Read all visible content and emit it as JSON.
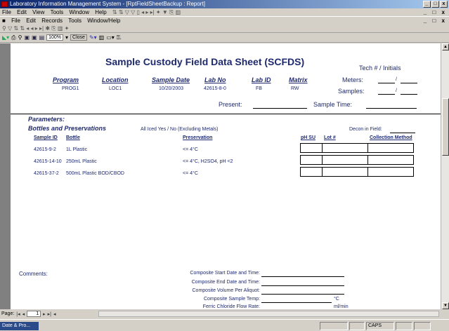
{
  "window": {
    "title": "Laboratory Information Management System - [RptFieldSheetBackup : Report]",
    "controls": [
      "_",
      "□",
      "x"
    ]
  },
  "menubar1": {
    "items": [
      "File",
      "Edit",
      "View",
      "Tools",
      "Window",
      "Help"
    ],
    "controls": [
      "_",
      "□",
      "x"
    ]
  },
  "menubar2": {
    "items": [
      "File",
      "Edit",
      "Records",
      "Tools",
      "Window/Help"
    ],
    "controls": [
      "_",
      "□",
      "x"
    ]
  },
  "toolbar": {
    "zoom": "100%",
    "close_label": "Close"
  },
  "report": {
    "title": "Sample Custody Field Data Sheet  (SCFDS)",
    "tech_label": "Tech # / Initials",
    "headers": {
      "program": "Program",
      "location": "Location",
      "sample_date": "Sample Date",
      "lab_no": "Lab No",
      "lab_id": "Lab ID",
      "matrix": "Matrix"
    },
    "values": {
      "program": "PROG1",
      "location": "LOC1",
      "sample_date": "10/20/2003",
      "lab_no": "42615-8-0",
      "lab_id": "FB",
      "matrix": "RW"
    },
    "meters_label": "Meters:",
    "samples_label": "Samples:",
    "slash": "/",
    "present_label": "Present:",
    "sample_time_label": "Sample Time:",
    "parameters_label": "Parameters:",
    "bottles_label": "Bottles and Preservations",
    "all_iced": "All Iced  Yes / No  (Excluding Metals)",
    "decon_label": "Decon in Field:",
    "columns": {
      "sample_id": "Sample ID",
      "bottle": "Bottle",
      "preservation": "Preservation",
      "ph_su": "pH SU",
      "lot": "Lot #",
      "collection_method": "Collection Method"
    },
    "rows": [
      {
        "sample_id": "42615-9-2",
        "bottle": "1L Plastic",
        "preservation": "<= 4°C"
      },
      {
        "sample_id": "42615-14-10",
        "bottle": "250mL Plastic",
        "preservation": "<= 4°C, H2SO4, pH <2"
      },
      {
        "sample_id": "42615-37-2",
        "bottle": "500mL Plastic BOD/CBOD",
        "preservation": "<= 4°C"
      }
    ],
    "comments_label": "Comments:",
    "composite": {
      "start": "Composite Start Date and Time:",
      "end": "Composite End Date and Time:",
      "volume": "Composite Volume Per Aliquot:",
      "temp": "Composite Sample Temp:",
      "temp_unit": "°C",
      "ferric": "Ferric Chloride Flow Rate:",
      "ferric_unit": "ml/min"
    }
  },
  "navigation": {
    "page_label": "Page:",
    "page_number": "1"
  },
  "statusbar": {
    "task": "Date & Pro...",
    "caps": "CAPS"
  }
}
